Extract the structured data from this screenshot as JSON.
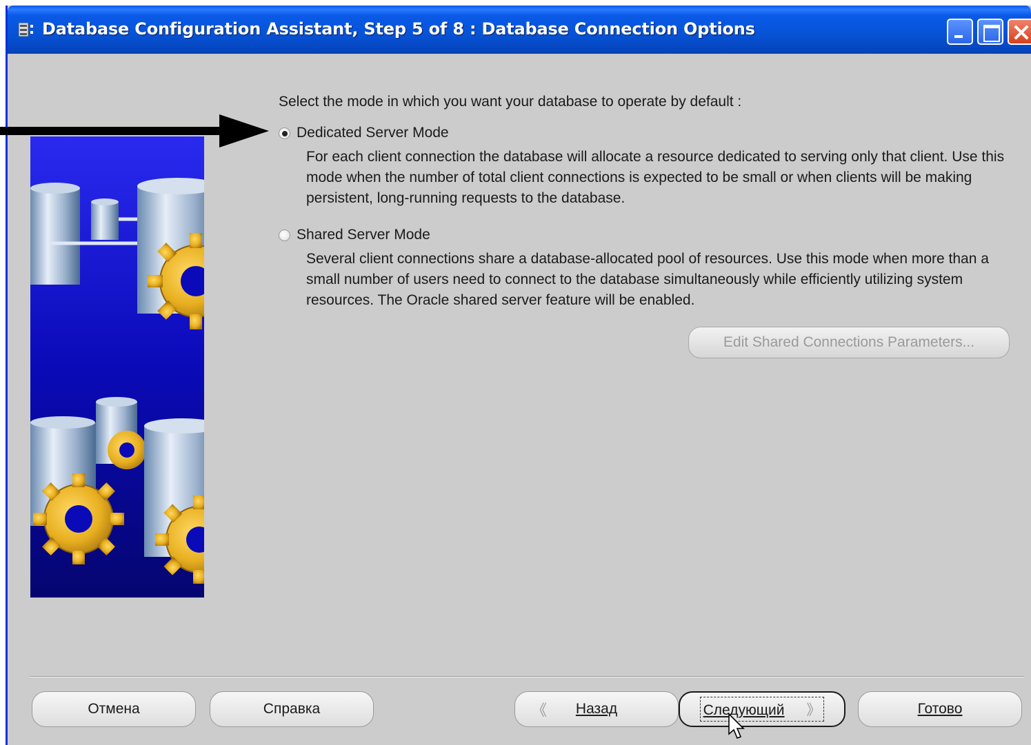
{
  "window": {
    "title": "Database Configuration Assistant, Step 5 of 8 : Database Connection Options"
  },
  "main": {
    "prompt": "Select the mode in which you want your database to operate by default :",
    "options": [
      {
        "label": "Dedicated Server Mode",
        "selected": true,
        "description": "For each client connection the database will allocate a resource dedicated to serving only that client.  Use this mode when the number of total client connections is expected to be small or when clients will be making persistent, long-running requests to the database."
      },
      {
        "label": "Shared Server Mode",
        "selected": false,
        "description": "Several client connections share a database-allocated pool of resources.  Use this mode when more than a small number of users need to connect to the database simultaneously while efficiently utilizing system resources.  The Oracle shared server feature will be enabled."
      }
    ],
    "edit_button": "Edit Shared Connections Parameters..."
  },
  "footer": {
    "cancel": "Отмена",
    "help": "Справка",
    "back": "Назад",
    "next": "Следующий",
    "finish": "Готово"
  },
  "colors": {
    "titlebar": "#0a5ae8",
    "window_bg": "#cccccc",
    "banner_blue": "#0a0ab8",
    "gear_gold": "#e8b020"
  },
  "icons": [
    "app-icon",
    "minimize-icon",
    "maximize-icon",
    "close-icon",
    "chevron-left-icon",
    "chevron-right-icon",
    "arrow-pointer-icon",
    "mouse-cursor-icon"
  ]
}
